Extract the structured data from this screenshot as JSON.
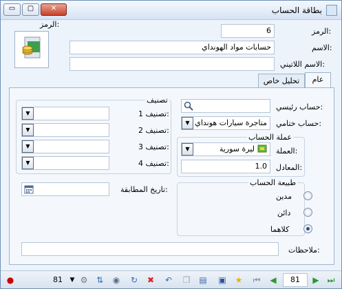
{
  "window": {
    "title": "بطاقة الحساب",
    "controls": {
      "minimize": "▭",
      "restore": "▢",
      "close": "✕"
    }
  },
  "header": {
    "symbol_label": "الرمز:",
    "code_label": "الرمز:",
    "code_value": "6",
    "name_label": "الاسم:",
    "name_value": "حسابات مواد الهونداي",
    "latin_name_label": "الاسم اللاتيني:",
    "latin_name_value": ""
  },
  "tabs": [
    {
      "label": "عام"
    },
    {
      "label": "تحليل خاص"
    }
  ],
  "general": {
    "main_account_label": "حساب رئيسي:",
    "main_account_value": "",
    "final_account_label": "حساب ختامي:",
    "final_account_value": "متاجرة سيارات هونداي",
    "currency_group_title": "عملة الحساب",
    "currency_label": "العملة:",
    "currency_value": "ليرة سورية",
    "rate_label": "المعادل:",
    "rate_value": "1.0",
    "nature_group_title": "طبيعة الحساب",
    "nature_options": [
      {
        "label": "مدين",
        "selected": false
      },
      {
        "label": "دائن",
        "selected": false
      },
      {
        "label": "كلاهما",
        "selected": true
      }
    ],
    "classification_title": "تصنيف",
    "classifications": [
      {
        "label": "تصنيف 1:",
        "value": ""
      },
      {
        "label": "تصنيف 2:",
        "value": ""
      },
      {
        "label": "تصنيف 3:",
        "value": ""
      },
      {
        "label": "تصنيف 4:",
        "value": ""
      }
    ],
    "match_date_label": "تاريخ المطابقة:",
    "match_date_value": "",
    "notes_label": "ملاحظات:",
    "notes_value": ""
  },
  "statusbar": {
    "record_number": "81",
    "record_count": "81",
    "icons": [
      "first-icon",
      "prev-icon",
      "next-icon",
      "last-icon",
      "bookmark-icon",
      "save-icon",
      "paste-icon",
      "copy-icon",
      "delete-icon",
      "cancel-icon",
      "refresh-icon",
      "view-icon",
      "sort-icon",
      "tools-icon"
    ]
  }
}
